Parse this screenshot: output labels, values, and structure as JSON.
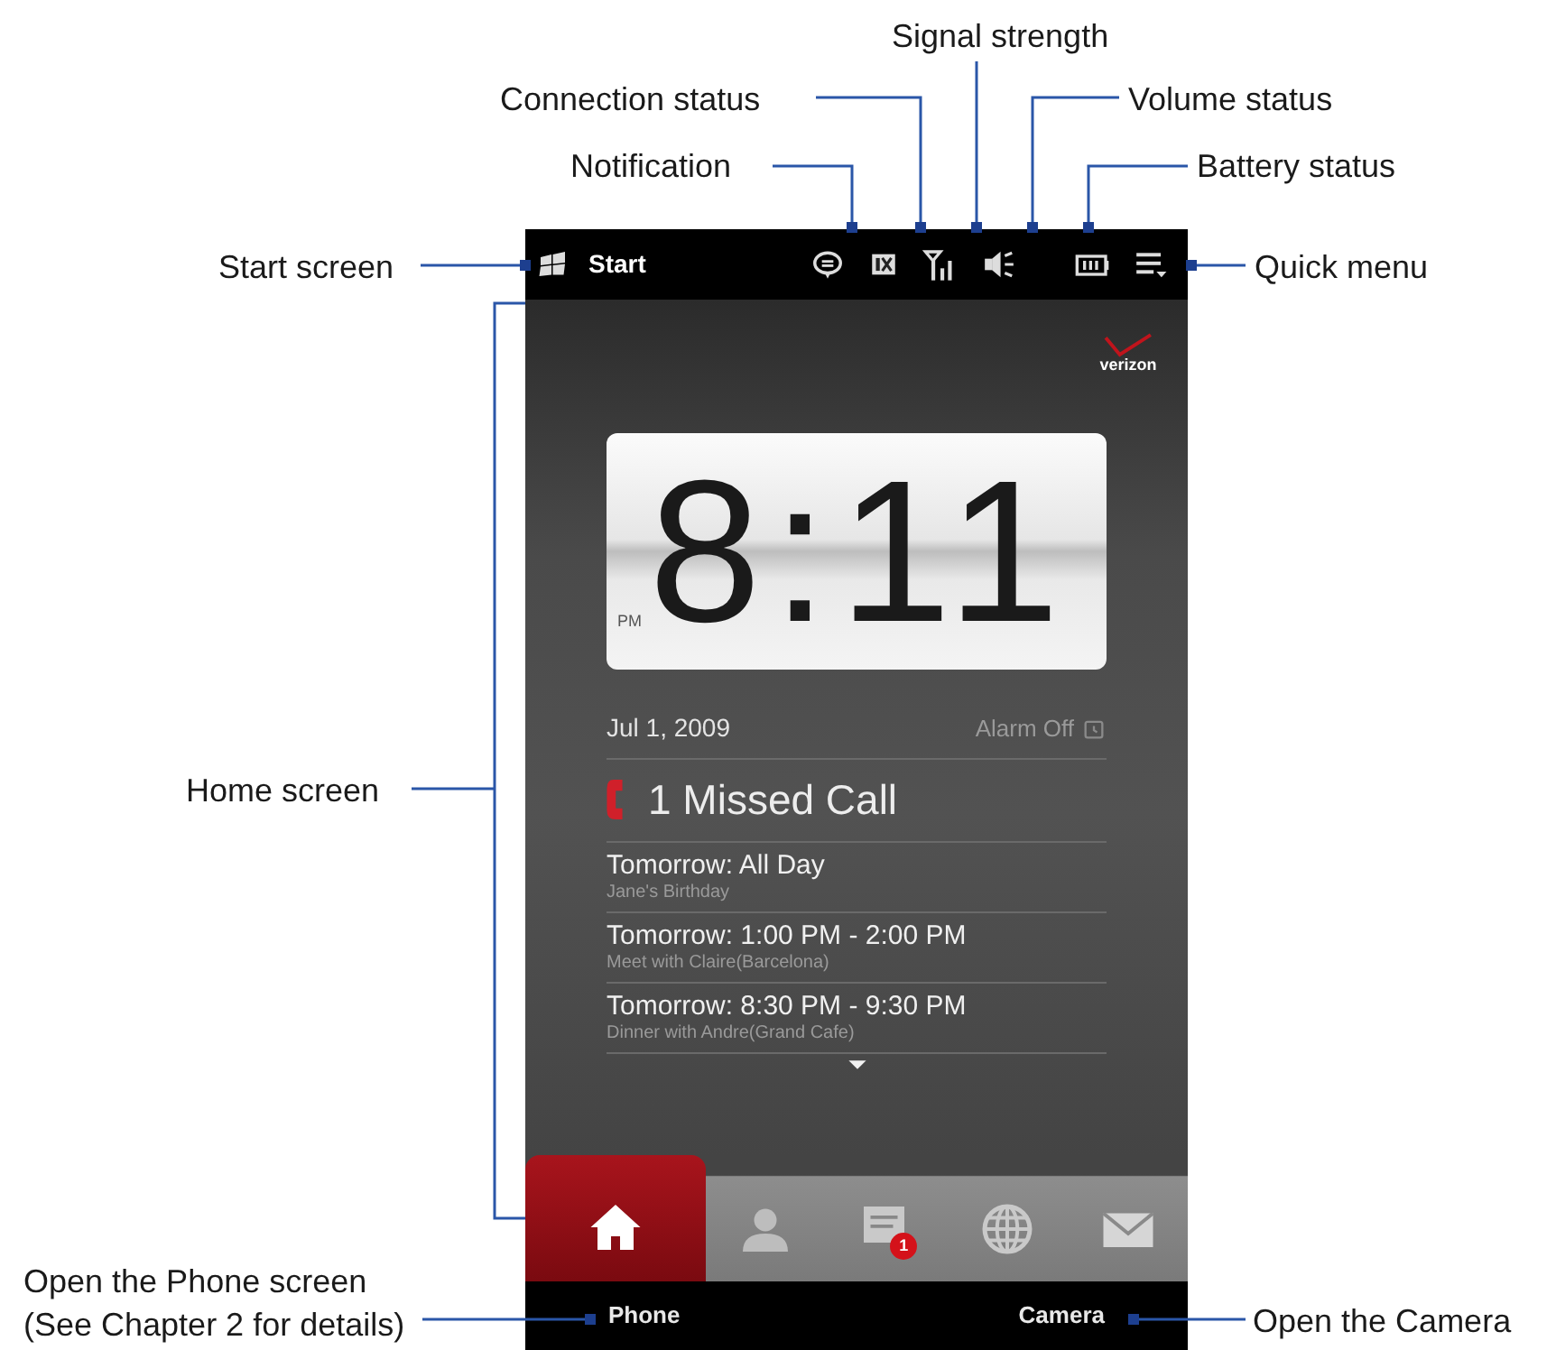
{
  "callouts": [
    {
      "text": "Signal strength"
    },
    {
      "text": "Connection status"
    },
    {
      "text": "Volume status"
    },
    {
      "text": "Notification"
    },
    {
      "text": "Battery status"
    },
    {
      "text": "Start screen"
    },
    {
      "text": "Quick menu"
    },
    {
      "text": "Home screen"
    },
    {
      "text": "Open the Phone screen\n(See Chapter 2 for details)"
    },
    {
      "text": "Open the Camera"
    }
  ],
  "phone": {
    "status_bar": {
      "start_label": "Start"
    },
    "home": {
      "logo": "verizon",
      "clock": {
        "time": "8:11",
        "period": "PM"
      },
      "date": "Jul 1, 2009",
      "alarm": "Alarm Off",
      "missed_call": "1 Missed Call",
      "events": [
        {
          "title": "Tomorrow: All Day",
          "detail": "Jane's Birthday"
        },
        {
          "title": "Tomorrow: 1:00 PM - 2:00 PM",
          "detail": "Meet with Claire(Barcelona)"
        },
        {
          "title": "Tomorrow: 8:30 PM - 9:30 PM",
          "detail": "Dinner with Andre(Grand Cafe)"
        }
      ]
    },
    "tabs": [
      {
        "kind": "home",
        "selected": true
      },
      {
        "kind": "contacts",
        "selected": false
      },
      {
        "kind": "messages",
        "selected": false,
        "badge": "1"
      },
      {
        "kind": "internet",
        "selected": false
      },
      {
        "kind": "mail",
        "selected": false
      }
    ],
    "soft_keys": [
      "Phone",
      "Camera"
    ]
  }
}
